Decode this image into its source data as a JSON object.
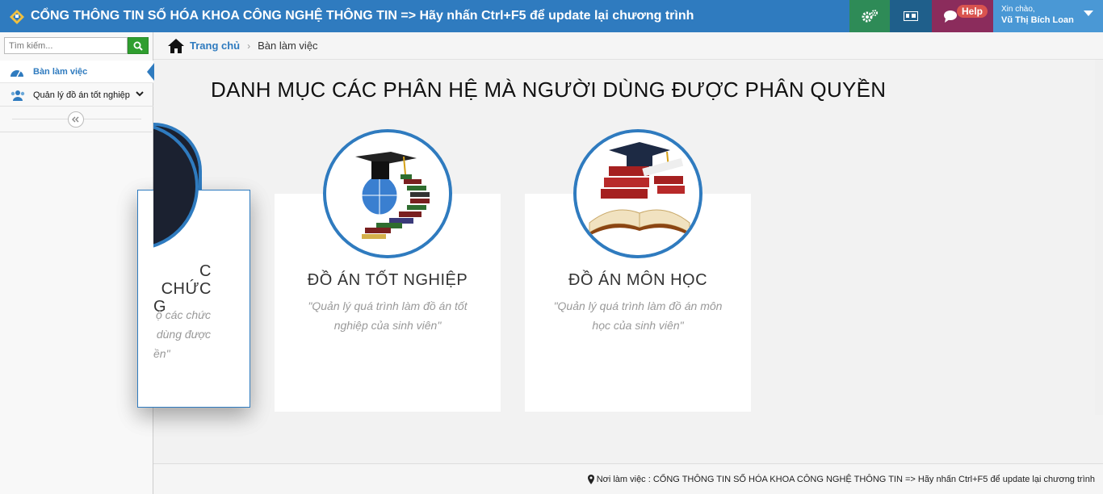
{
  "header": {
    "title": "CỔNG THÔNG TIN SỐ HÓA KHOA CÔNG NGHỆ THÔNG TIN => Hãy nhấn Ctrl+F5 để update lại chương trình",
    "help_label": "Help",
    "greeting": "Xin chào,",
    "user_name": "Vũ Thị Bích Loan",
    "icons": [
      "logo-icon",
      "gears-icon",
      "keyboard-icon",
      "chat-icon",
      "caret-down-icon"
    ],
    "colors": {
      "primary": "#2f7bbf",
      "settings": "#2e8b57",
      "keyboard": "#1f5f8b",
      "help": "#8b2c5c",
      "user": "#4a98d5"
    }
  },
  "sidebar": {
    "search_placeholder": "Tìm kiếm...",
    "items": [
      {
        "label": "Bàn làm việc",
        "icon": "dashboard-icon",
        "active": true
      },
      {
        "label": "Quản lý đồ án tốt nghiệp",
        "icon": "users-icon",
        "active": false
      }
    ],
    "collapse_icon": "double-chevron-left-icon"
  },
  "breadcrumb": {
    "home": "Trang chủ",
    "current": "Bàn làm việc"
  },
  "main": {
    "heading": "DANH MỤC CÁC PHÂN HỆ MÀ NGƯỜI DÙNG ĐƯỢC PHÂN QUYỀN",
    "partial_card": {
      "title_line1": "C CHỨC",
      "title_line2": "G",
      "desc_line1": "ộ các chức",
      "desc_line2": "dùng được",
      "desc_line3": "ền\""
    },
    "cards": [
      {
        "title": "ĐỒ ÁN TỐT NGHIỆP",
        "description": "\"Quản lý quá trình làm đồ án tốt nghiệp của sinh viên\"",
        "icon": "graduation-books-globe-icon"
      },
      {
        "title": "ĐỒ ÁN MÔN HỌC",
        "description": "\"Quản lý quá trình làm đồ án môn học của sinh viên\"",
        "icon": "graduation-cap-open-book-icon"
      }
    ]
  },
  "footer": {
    "text": "Nơi làm việc : CỔNG THÔNG TIN SỐ HÓA KHOA CÔNG NGHỆ THÔNG TIN => Hãy nhấn Ctrl+F5 để update lại chương trình"
  }
}
